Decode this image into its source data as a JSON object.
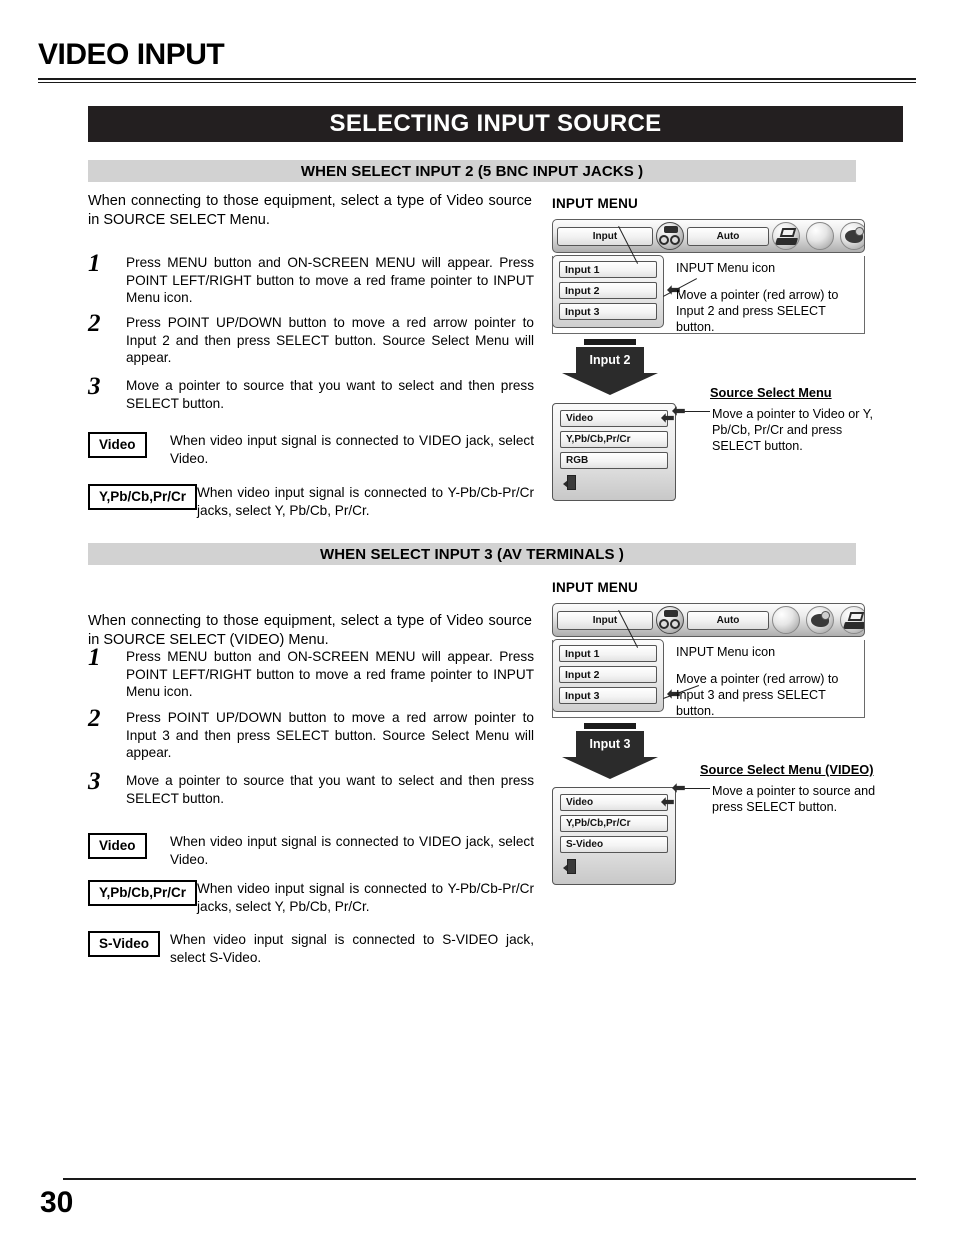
{
  "header": {
    "title": "VIDEO INPUT",
    "banner": "SELECTING INPUT SOURCE"
  },
  "sections": [
    {
      "heading": "WHEN SELECT INPUT 2 (5 BNC INPUT JACKS )",
      "intro": "When connecting to those equipment, select a type of Video source in SOURCE SELECT Menu.",
      "steps": [
        {
          "num": "1",
          "text": "Press MENU button and ON-SCREEN MENU will appear.  Press POINT LEFT/RIGHT button to move a red frame pointer to INPUT Menu icon."
        },
        {
          "num": "2",
          "text": "Press POINT UP/DOWN button to move a red arrow pointer to Input 2 and then press SELECT button.  Source Select Menu will appear."
        },
        {
          "num": "3",
          "text": "Move a pointer to source that you want to select and then press SELECT button."
        }
      ],
      "callouts": [
        {
          "cap": "Video",
          "text": "When video input signal is connected to VIDEO jack, select Video."
        },
        {
          "cap": "Y,Pb/Cb,Pr/Cr",
          "text": "When video input signal is connected to Y-Pb/Cb-Pr/Cr jacks, select Y, Pb/Cb, Pr/Cr."
        }
      ],
      "diagram": {
        "label": "INPUT MENU",
        "menubar": {
          "input_button": "Input",
          "auto_button": "Auto",
          "icons": [
            "input-source-icon",
            "laptop-icon",
            "bar-graph-icon",
            "palette-icon"
          ]
        },
        "input_list": [
          "Input 1",
          "Input 2",
          "Input 3"
        ],
        "pointer_on": "Input 2",
        "anno_icon": "INPUT Menu icon",
        "anno_pointer": "Move a pointer (red arrow) to Input 2 and press SELECT button.",
        "arrow_banner": "Input 2",
        "source_menu_title": "Source Select Menu",
        "source_items": [
          "Video",
          "Y,Pb/Cb,Pr/Cr",
          "RGB"
        ],
        "source_exit_icon": "exit-icon",
        "source_anno": "Move a pointer to Video or Y, Pb/Cb, Pr/Cr and press SELECT button."
      }
    },
    {
      "heading": "WHEN SELECT INPUT 3 (AV TERMINALS )",
      "intro": "When connecting to those equipment, select a type of Video source in SOURCE SELECT (VIDEO) Menu.",
      "steps": [
        {
          "num": "1",
          "text": "Press MENU button and ON-SCREEN MENU will appear.  Press POINT LEFT/RIGHT button to move a red frame pointer to INPUT Menu icon."
        },
        {
          "num": "2",
          "text": "Press POINT UP/DOWN button to move a red arrow pointer to Input 3 and then press SELECT button.  Source Select Menu will appear."
        },
        {
          "num": "3",
          "text": "Move a pointer to source that you want to select and then press SELECT button."
        }
      ],
      "callouts": [
        {
          "cap": "Video",
          "text": "When video input signal is connected to VIDEO jack, select Video."
        },
        {
          "cap": "Y,Pb/Cb,Pr/Cr",
          "text": "When video input signal is connected to Y-Pb/Cb-Pr/Cr jacks, select Y, Pb/Cb, Pr/Cr."
        },
        {
          "cap": "S-Video",
          "text": "When video input signal is connected to S-VIDEO jack, select S-Video."
        }
      ],
      "diagram": {
        "label": "INPUT MENU",
        "menubar": {
          "input_button": "Input",
          "auto_button": "Auto",
          "icons": [
            "input-source-icon",
            "bar-graph-icon",
            "palette-icon",
            "laptop-icon"
          ]
        },
        "input_list": [
          "Input 1",
          "Input 2",
          "Input 3"
        ],
        "pointer_on": "Input 3",
        "anno_icon": "INPUT Menu icon",
        "anno_pointer": "Move a pointer (red arrow) to Input 3 and press SELECT button.",
        "arrow_banner": "Input 3",
        "source_menu_title": "Source Select Menu (VIDEO)",
        "source_items": [
          "Video",
          "Y,Pb/Cb,Pr/Cr",
          "S-Video"
        ],
        "source_exit_icon": "exit-icon",
        "source_anno": "Move a pointer to source and press SELECT button."
      }
    }
  ],
  "footer": {
    "page_number": "30"
  }
}
